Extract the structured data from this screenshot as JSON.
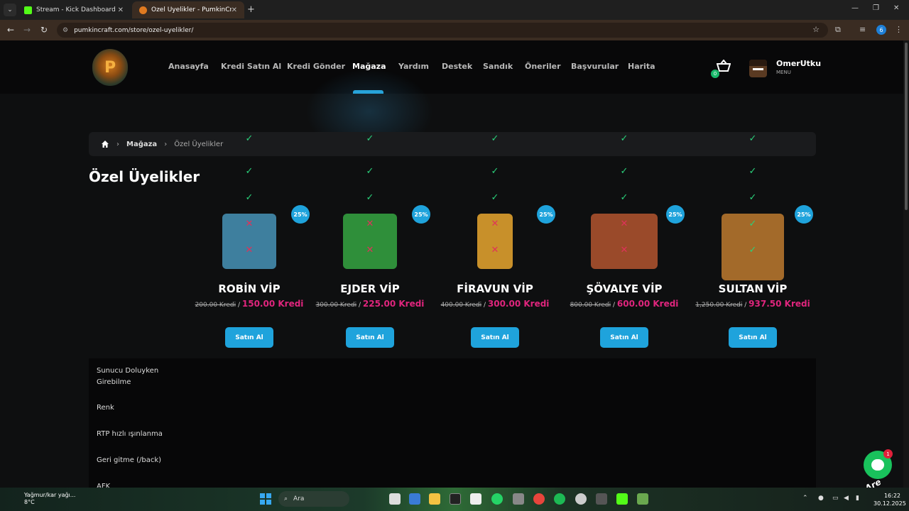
{
  "browser": {
    "tabs": [
      {
        "title": "Stream - Kick Dashboard"
      },
      {
        "title": "Özel Üyelikler - PumkinCraft"
      }
    ],
    "url": "pumkincraft.com/store/ozel-uyelikler/",
    "profile_initial": "6"
  },
  "site": {
    "logo_text": "P",
    "nav": [
      "Anasayfa",
      "Kredi Satın Al",
      "Kredi Gönder",
      "Mağaza",
      "Yardım",
      "Destek",
      "Sandık",
      "Öneriler",
      "Başvurular",
      "Harita"
    ],
    "active_nav": "Mağaza",
    "cart_count": "0",
    "user": {
      "name": "OmerUtku",
      "menu": "MENU"
    }
  },
  "breadcrumb": {
    "store": "Mağaza",
    "current": "Özel Üyelikler"
  },
  "page_title": "Özel Üyelikler",
  "products": [
    {
      "name": "ROBİN VİP",
      "discount": "25%",
      "old_price": "200.00 Kredi",
      "sep": "/",
      "new_price": "150.00 Kredi",
      "buy": "Satın Al",
      "art_color": "#3e7f9e"
    },
    {
      "name": "EJDER VİP",
      "discount": "25%",
      "old_price": "300.00 Kredi",
      "sep": "/",
      "new_price": "225.00 Kredi",
      "buy": "Satın Al",
      "art_color": "#2f8f3a"
    },
    {
      "name": "FİRAVUN VİP",
      "discount": "25%",
      "old_price": "400.00 Kredi",
      "sep": "/",
      "new_price": "300.00 Kredi",
      "buy": "Satın Al",
      "art_color": "#c8902a"
    },
    {
      "name": "ŞÖVALYE VİP",
      "discount": "25%",
      "old_price": "800.00 Kredi",
      "sep": "/",
      "new_price": "600.00 Kredi",
      "buy": "Satın Al",
      "art_color": "#9a4a2a"
    },
    {
      "name": "SULTAN VİP",
      "discount": "25%",
      "old_price": "1,250.00 Kredi",
      "sep": "/",
      "new_price": "937.50 Kredi",
      "buy": "Satın Al",
      "art_color": "#a36a2a"
    }
  ],
  "features": [
    {
      "label": "Sunucu Doluyken Girebilme",
      "values": [
        true,
        true,
        true,
        true,
        true
      ]
    },
    {
      "label": "Renk",
      "values": [
        true,
        true,
        true,
        true,
        true
      ]
    },
    {
      "label": "RTP hızlı ışınlanma",
      "values": [
        true,
        true,
        true,
        true,
        true
      ]
    },
    {
      "label": "Geri gitme (/back)",
      "values": [
        false,
        false,
        false,
        false,
        true
      ]
    },
    {
      "label": "AFK",
      "values": [
        false,
        false,
        false,
        false,
        true
      ]
    }
  ],
  "chat_widget": {
    "text": "We Are Here!",
    "badge": "1"
  },
  "taskbar": {
    "weather": "Yağmur/kar yağı...",
    "temp": "8°C",
    "search": "Ara",
    "time": "16:22",
    "date": "30.12.2025"
  }
}
